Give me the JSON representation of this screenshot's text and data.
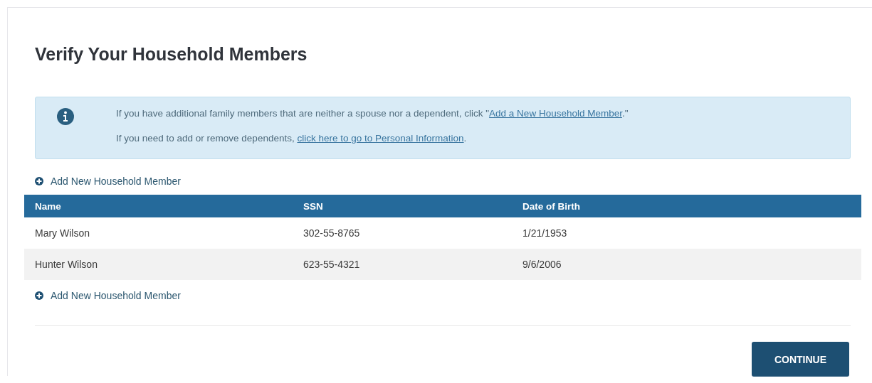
{
  "title": "Verify Your Household Members",
  "info": [
    {
      "before": "If you have additional family members that are neither a spouse nor a dependent, click \"",
      "link": "Add a New Household Member",
      "after": ".\""
    },
    {
      "before": "If you need to add or remove dependents, ",
      "link": "click here to go to Personal Information",
      "after": "."
    }
  ],
  "add_link_top": "Add New Household Member",
  "table": {
    "columns": [
      "Name",
      "SSN",
      "Date of Birth"
    ],
    "rows": [
      [
        "Mary Wilson",
        "302-55-8765",
        "1/21/1953"
      ],
      [
        "Hunter Wilson",
        "623-55-4321",
        "9/6/2006"
      ]
    ]
  },
  "add_link_bottom": "Add New Household Member",
  "continue_button": "CONTINUE"
}
